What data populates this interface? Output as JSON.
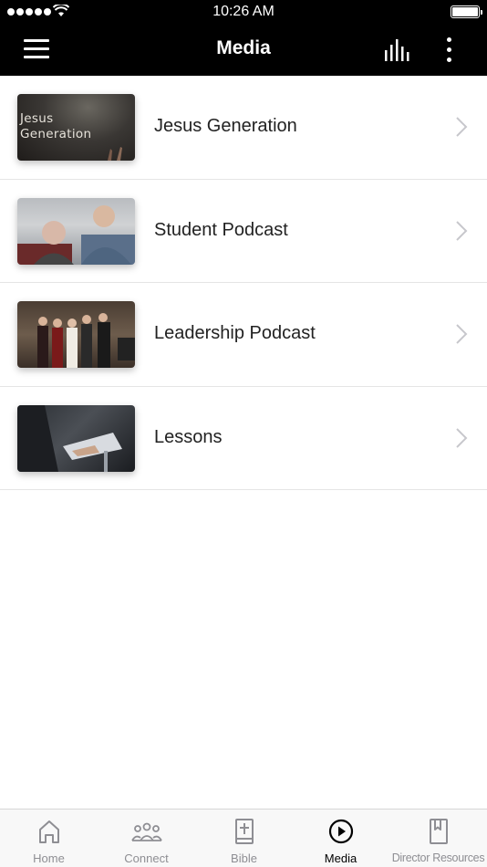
{
  "status_bar": {
    "time": "10:26 AM"
  },
  "nav": {
    "title": "Media",
    "left_icon": "hamburger-menu-icon",
    "right_icons": [
      "equalizer-icon",
      "more-vertical-icon"
    ]
  },
  "media_items": [
    {
      "label": "Jesus Generation",
      "thumbnail_text": "Jesus Generation"
    },
    {
      "label": "Student Podcast"
    },
    {
      "label": "Leadership Podcast"
    },
    {
      "label": "Lessons"
    }
  ],
  "tabs": [
    {
      "label": "Home",
      "icon": "home-icon",
      "active": false
    },
    {
      "label": "Connect",
      "icon": "people-group-icon",
      "active": false
    },
    {
      "label": "Bible",
      "icon": "bible-icon",
      "active": false
    },
    {
      "label": "Media",
      "icon": "play-circle-icon",
      "active": true
    },
    {
      "label": "Director Resources",
      "icon": "bookmark-book-icon",
      "active": false
    }
  ],
  "colors": {
    "header_bg": "#000000",
    "active_tab": "#000000",
    "inactive_tab": "#8e8e93",
    "divider": "#e5e5e5"
  }
}
